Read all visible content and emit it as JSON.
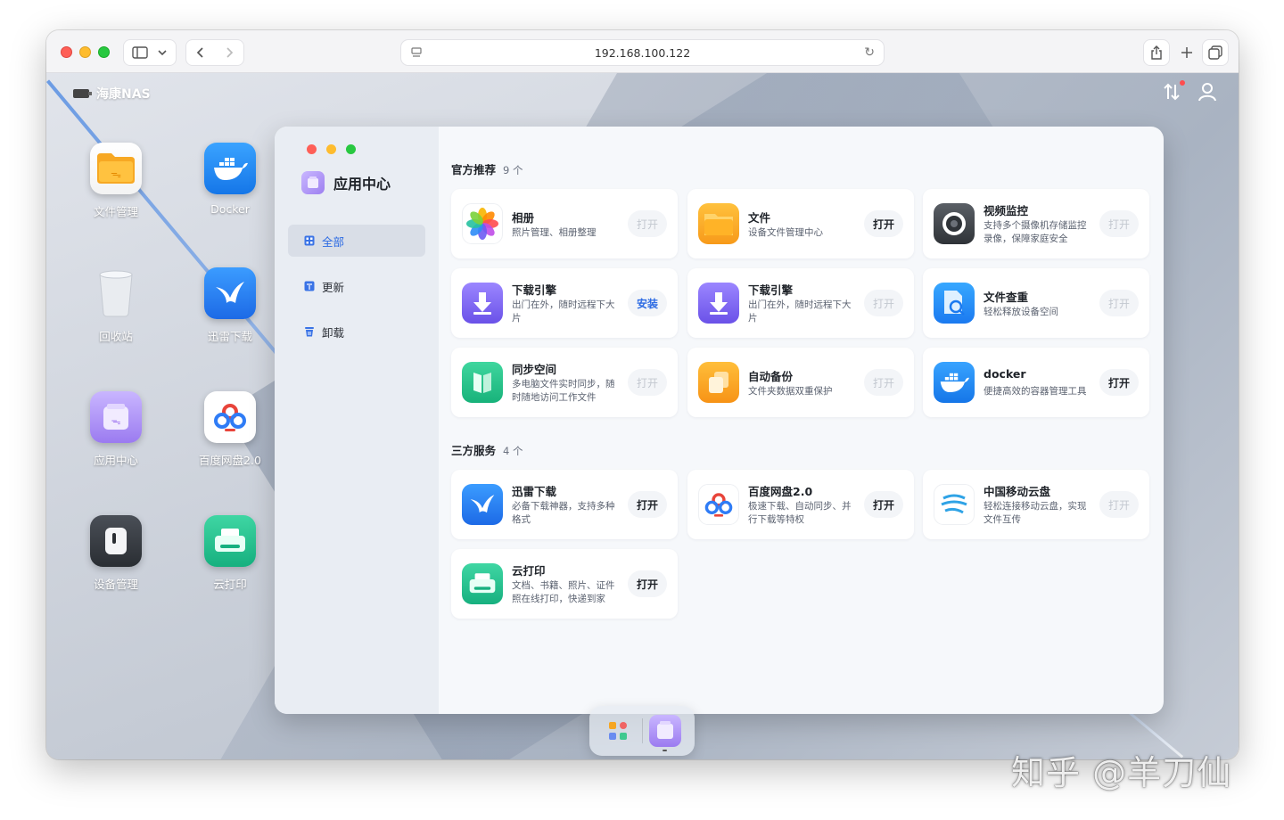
{
  "browser": {
    "url": "192.168.100.122"
  },
  "desktop": {
    "brand": "海康NAS",
    "icons": [
      {
        "label": "文件管理"
      },
      {
        "label": "Docker"
      },
      {
        "label": "回收站"
      },
      {
        "label": "迅雷下载"
      },
      {
        "label": "应用中心"
      },
      {
        "label": "百度网盘2.0"
      },
      {
        "label": "设备管理"
      },
      {
        "label": "云打印"
      }
    ]
  },
  "app_center": {
    "title": "应用中心",
    "nav": [
      {
        "label": "全部",
        "active": true
      },
      {
        "label": "更新",
        "active": false
      },
      {
        "label": "卸载",
        "active": false
      }
    ],
    "sections": [
      {
        "title": "官方推荐",
        "count": "9 个",
        "apps": [
          {
            "name": "相册",
            "desc": "照片管理、相册整理",
            "action": "打开",
            "state": "disabled"
          },
          {
            "name": "文件",
            "desc": "设备文件管理中心",
            "action": "打开",
            "state": "enabled"
          },
          {
            "name": "视频监控",
            "desc": "支持多个摄像机存储监控录像，保障家庭安全",
            "action": "打开",
            "state": "disabled"
          },
          {
            "name": "下载引擎",
            "desc": "出门在外，随时远程下大片",
            "action": "安装",
            "state": "install"
          },
          {
            "name": "下载引擎",
            "desc": "出门在外，随时远程下大片",
            "action": "打开",
            "state": "disabled"
          },
          {
            "name": "文件查重",
            "desc": "轻松释放设备空间",
            "action": "打开",
            "state": "disabled"
          },
          {
            "name": "同步空间",
            "desc": "多电脑文件实时同步，随时随地访问工作文件",
            "action": "打开",
            "state": "disabled"
          },
          {
            "name": "自动备份",
            "desc": "文件夹数据双重保护",
            "action": "打开",
            "state": "disabled"
          },
          {
            "name": "docker",
            "desc": "便捷高效的容器管理工具",
            "action": "打开",
            "state": "enabled"
          }
        ]
      },
      {
        "title": "三方服务",
        "count": "4 个",
        "apps": [
          {
            "name": "迅雷下载",
            "desc": "必备下载神器，支持多种格式",
            "action": "打开",
            "state": "enabled"
          },
          {
            "name": "百度网盘2.0",
            "desc": "极速下载、自动同步、并行下载等特权",
            "action": "打开",
            "state": "enabled"
          },
          {
            "name": "中国移动云盘",
            "desc": "轻松连接移动云盘，实现文件互传",
            "action": "打开",
            "state": "disabled"
          },
          {
            "name": "云打印",
            "desc": "文档、书籍、照片、证件照在线打印，快递到家",
            "action": "打开",
            "state": "enabled"
          }
        ]
      }
    ]
  },
  "watermark": "知乎 @羊刀仙",
  "colors": {
    "accent": "#2d6be3",
    "disabled_text": "#c3c8d0",
    "sidebar_bg": "#e9edf3"
  }
}
